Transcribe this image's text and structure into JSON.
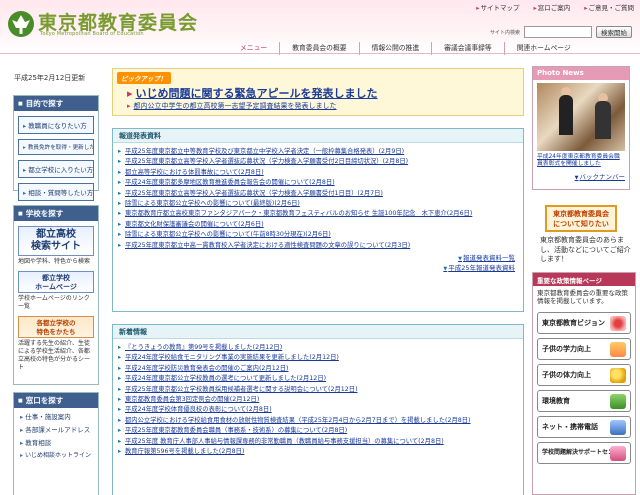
{
  "header": {
    "logo_title": "東京都教育委員会",
    "logo_sub": "Tokyo Metropolitan Board of Education",
    "toplinks": [
      "サイトマップ",
      "窓口ご案内",
      "ご意見・ご質問"
    ],
    "search_label": "サイト内検索",
    "search_button": "検索開始",
    "gnav": [
      "メニュー",
      "教育委員会の概要",
      "情報公開の推進",
      "審議会議事録等",
      "関連ホームページ"
    ]
  },
  "date": "平成25年2月12日更新",
  "side": {
    "purpose": {
      "title": "目的で探す",
      "items": [
        "教職員になりたい方",
        "教員免許を取得・更新したい方",
        "都立学校に入りたい方",
        "相談・質問等したい方"
      ]
    },
    "schools": {
      "title": "学校を探す",
      "banner1": "都立高校\n検索サイト",
      "banner1_caption": "地図や学科、特色から検索",
      "banner2": "都立学校\nホームページ",
      "banner2_caption": "学校ホームページのリンク一覧",
      "banner3": "各都立学校の\n特色をかたち",
      "banner3_caption": "活躍する先生の紹介、生徒による学校生活紹介、各都立高校の特色が分かるシート"
    },
    "window": {
      "title": "窓口を探す",
      "items": [
        "仕事・施設案内",
        "各部課メールアドレス",
        "教育相談",
        "いじめ相談ホットライン"
      ]
    }
  },
  "pickup": {
    "badge": "ピックアップ！",
    "main": "いじめ問題に関する緊急アピールを発表しました",
    "sub": "都内公立中学生の都立高校第一志望予定調査結果を発表しました"
  },
  "press": {
    "title": "報道発表資料",
    "items": [
      "平成25年度東京都立中等教育学校及び東京都立中学校入学者決定（一般枠募集合格発表）(2月9日)",
      "平成25年度東京都立高等学校入学者選抜応募状況（学力検査入学願書受付2日目締切状況）(2月8日)",
      "都立高等学校における体罰事故について(2月8日)",
      "平成24年度東京都多摩地区教育推進委員会報告会の開催について(2月8日)",
      "平成25年度東京都立高等学校入学者選抜応募状況（学力検査入学願書受付1日目）(2月7日)",
      "除雪による東京都公立学校への影響について(最終版)(2月6日)",
      "東京都教育庁都立高校東京ファンタジアパーク・東京都教育フェスティバルのお知らせ 生誕100年記念　木下恵介(2月6日)",
      "東京都文化財保護審議会の開催について(2月6日)",
      "除雪による東京都公立学校への影響について(午前8時30分現在)(2月6日)",
      "平成25年度東京都立中高一貫教育校入学者決定における適性検査問題の文章の誤りについて(2月3日)"
    ],
    "more1": "報道発表資料一覧",
    "more2": "平成25年報道発表資料"
  },
  "whatsnew": {
    "title": "新着情報",
    "items": [
      "『とうきょうの教育』第99号を掲載しました(2月12日)",
      "平成24年度学校給食モニタリング事業の実施結果を更新しました(2月12日)",
      "平成24年度学校防災教育発表会の開催のご案内(2月12日)",
      "平成24年度東京都公立学校教員の選考について更新しました(2月12日)",
      "平成25年度東京都公立学校教員採用候補者選考に関する説明会について(2月12日)",
      "東京都教育委員会第3回定例会の開催(2月12日)",
      "平成24年度学校体育優良校の表彰について(2月8日)",
      "都内公立学校における学校給食用食材の放射性物質検査結果（平成25年2月4日から2月7日まで）を掲載しました(2月8日)",
      "平成25年度東京都教育委員会職員（事務系・技術系）の募集について(2月8日)",
      "平成25年度 教育庁人事部人事給与情報課専務的非常勤職員（教職員給与事務支援担当）の募集について(2月8日)",
      "教育庁報第596号を掲載しました(2月8日)"
    ]
  },
  "photo": {
    "title": "Photo News",
    "caption": "平成24年度東京都教育委員会職員表彰式を開催しました",
    "more": "バックナンバー"
  },
  "linkus": {
    "banner": "東京都教育委員会\nについて知りたい",
    "text": "東京都教育委員会のあらまし、活動などについてご紹介します！"
  },
  "policy": {
    "title": "重要な政策情報ページ",
    "text": "東京都教育委員会の重要な政策情報を掲載しています。",
    "items": [
      "東京都教育ビジョン",
      "子供の学力向上",
      "子供の体力向上",
      "環境教育",
      "ネット・携帯電話",
      "学校問題解決サポートセンター"
    ]
  }
}
